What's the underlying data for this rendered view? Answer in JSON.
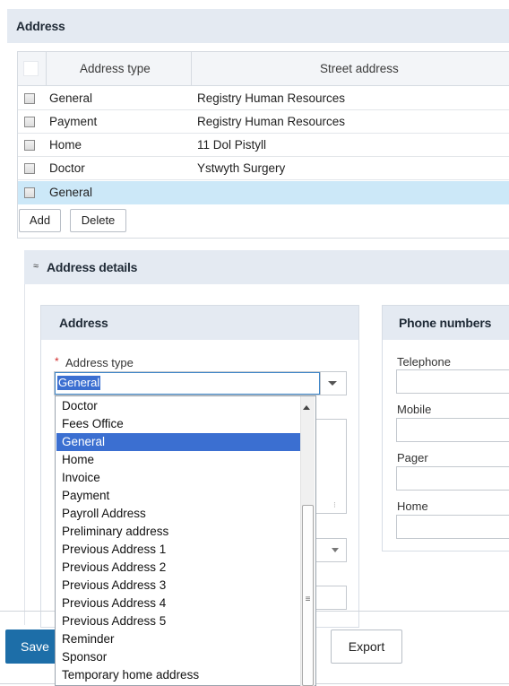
{
  "section": {
    "title": "Address"
  },
  "grid": {
    "columns": [
      "Address type",
      "Street address"
    ],
    "rows": [
      {
        "type": "General",
        "street": "Registry Human Resources"
      },
      {
        "type": "Payment",
        "street": "Registry Human Resources"
      },
      {
        "type": "Home",
        "street": "11 Dol Pistyll"
      },
      {
        "type": "Doctor",
        "street": "Ystwyth Surgery"
      },
      {
        "type": "General",
        "street": ""
      }
    ],
    "add_label": "Add",
    "delete_label": "Delete"
  },
  "details": {
    "title": "Address details",
    "chevron": "≈",
    "address_panel": {
      "title": "Address",
      "address_type_label": "Address type",
      "required_mark": "*",
      "address_type_value": "General"
    },
    "dropdown_options": [
      "Doctor",
      "Fees Office",
      "General",
      "Home",
      "Invoice",
      "Payment",
      "Payroll Address",
      "Preliminary address",
      "Previous Address 1",
      "Previous Address 2",
      "Previous Address 3",
      "Previous Address 4",
      "Previous Address 5",
      "Reminder",
      "Sponsor",
      "Temporary home address"
    ],
    "selected_option": "General",
    "phone_panel": {
      "title": "Phone numbers",
      "telephone_label": "Telephone",
      "mobile_label": "Mobile",
      "pager_label": "Pager",
      "home_label": "Home"
    }
  },
  "footer": {
    "save_label": "Save",
    "export_label": "Export"
  }
}
